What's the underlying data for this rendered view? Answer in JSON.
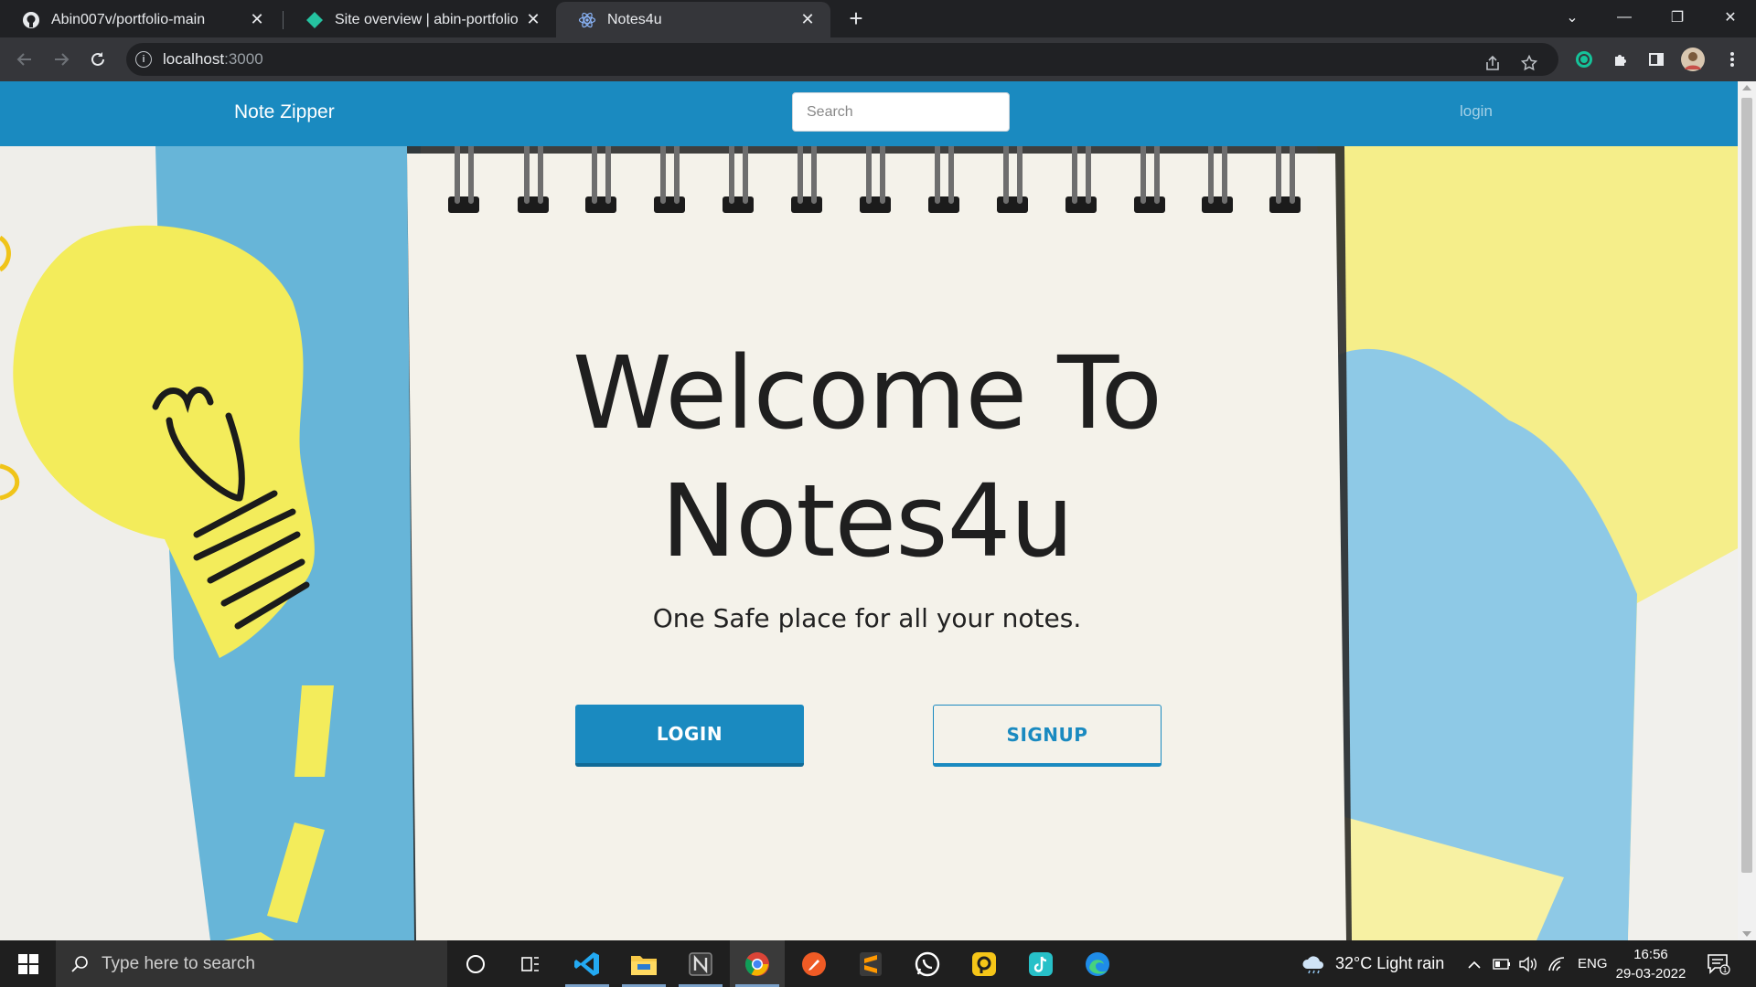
{
  "browser": {
    "tabs": [
      {
        "title": "Abin007v/portfolio-main",
        "icon": "github-icon"
      },
      {
        "title": "Site overview | abin-portfolio",
        "icon": "netlify-icon"
      },
      {
        "title": "Notes4u",
        "icon": "react-icon",
        "active": true
      }
    ],
    "url_host": "localhost",
    "url_port": ":3000"
  },
  "page": {
    "brand": "Note Zipper",
    "search_placeholder": "Search",
    "nav_login": "login",
    "hero_title_line1": "Welcome To",
    "hero_title_line2": "Notes4u",
    "hero_subtitle": "One Safe place for all your notes.",
    "login_button": "LOGIN",
    "signup_button": "SIGNUP",
    "accent_color": "#1a8ac0"
  },
  "taskbar": {
    "search_placeholder": "Type here to search",
    "apps": [
      "cortana-icon",
      "task-view-icon",
      "vscode-icon",
      "file-explorer-icon",
      "notion-icon",
      "chrome-icon",
      "postman-icon",
      "sublime-text-icon",
      "whatsapp-icon",
      "plex-icon",
      "tiktok-icon",
      "edge-icon"
    ],
    "weather": "32°C  Light rain",
    "language": "ENG",
    "time": "16:56",
    "date": "29-03-2022",
    "notification_count": "1"
  }
}
